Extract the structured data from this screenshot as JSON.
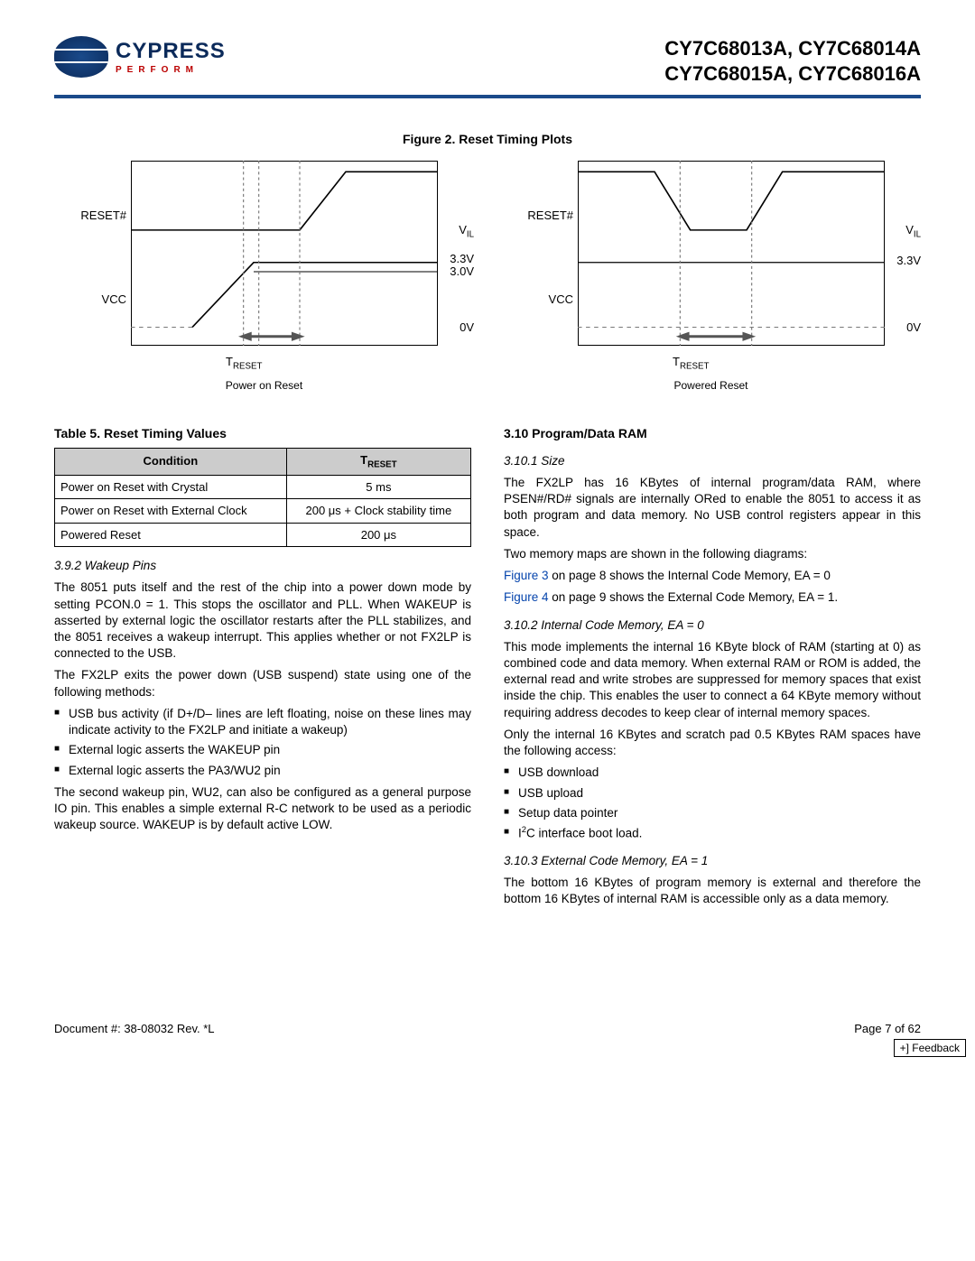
{
  "header": {
    "brand": "CYPRESS",
    "tagline": "PERFORM",
    "parts_line1": "CY7C68013A, CY7C68014A",
    "parts_line2": "CY7C68015A, CY7C68016A"
  },
  "figure": {
    "caption": "Figure 2.  Reset Timing Plots",
    "left": {
      "y_reset": "RESET#",
      "y_vcc": "VCC",
      "r_vil": "VIL",
      "r_33": "3.3V",
      "r_30": "3.0V",
      "r_0": "0V",
      "treset": "TRESET",
      "sub": "Power on Reset"
    },
    "right": {
      "y_reset": "RESET#",
      "y_vcc": "VCC",
      "r_vil": "VIL",
      "r_33": "3.3V",
      "r_0": "0V",
      "treset": "TRESET",
      "sub": "Powered Reset"
    }
  },
  "table5": {
    "caption": "Table 5.  Reset Timing Values",
    "headers": {
      "cond": "Condition",
      "treset": "TRESET"
    },
    "rows": [
      {
        "cond": "Power on Reset with Crystal",
        "val": "5 ms"
      },
      {
        "cond": "Power on Reset with External Clock",
        "val": "200 μs + Clock stability time"
      },
      {
        "cond": "Powered Reset",
        "val": "200 μs"
      }
    ]
  },
  "left": {
    "s392_h": "3.9.2  Wakeup Pins",
    "s392_p1": "The 8051 puts itself and the rest of the chip into a power down mode by setting PCON.0 = 1. This stops the oscillator and PLL. When WAKEUP is asserted by external logic the oscillator restarts after the PLL stabilizes, and the 8051 receives a wakeup interrupt. This applies whether or not FX2LP is connected to the USB.",
    "s392_p2": "The FX2LP exits the power down (USB suspend) state using one of the following methods:",
    "s392_li1": "USB bus activity (if D+/D– lines are left floating, noise on these lines may indicate activity to the FX2LP and initiate a wakeup)",
    "s392_li2": "External logic asserts the WAKEUP pin",
    "s392_li3": "External logic asserts the PA3/WU2 pin",
    "s392_p3": "The second wakeup pin, WU2, can also be configured as a general purpose IO pin. This enables a simple external R-C network to be used as a periodic wakeup source. WAKEUP is by default active LOW."
  },
  "right": {
    "s310_h": "3.10  Program/Data RAM",
    "s3101_h": "3.10.1  Size",
    "s3101_p1": "The FX2LP has 16 KBytes of internal program/data RAM, where PSEN#/RD# signals are internally ORed to enable the 8051 to access it as both program and data memory. No USB control registers appear in this space.",
    "s3101_p2": "Two memory maps are shown in the following diagrams:",
    "s3101_l1a": "Figure 3",
    "s3101_l1b": " on page 8 shows the Internal Code Memory, EA = 0",
    "s3101_l2a": "Figure 4",
    "s3101_l2b": " on page 9 shows the External Code Memory, EA = 1.",
    "s3102_h": "3.10.2  Internal Code Memory, EA = 0",
    "s3102_p1": "This mode implements the internal 16 KByte block of RAM (starting at 0) as combined code and data memory. When external RAM or ROM is added, the external read and write strobes are suppressed for memory spaces that exist inside the chip. This enables the user to connect a 64 KByte memory without requiring address decodes to keep clear of internal memory spaces.",
    "s3102_p2": "Only the internal 16 KBytes and scratch pad 0.5 KBytes RAM spaces have the following access:",
    "s3102_li1": "USB download",
    "s3102_li2": "USB upload",
    "s3102_li3": "Setup data pointer",
    "s3102_li4_a": "I",
    "s3102_li4_b": "C interface boot load.",
    "s3103_h": "3.10.3  External Code Memory, EA = 1",
    "s3103_p1": "The bottom 16 KBytes of program memory is external and therefore the bottom 16 KBytes of internal RAM is accessible only as a data memory."
  },
  "footer": {
    "doc": "Document #: 38-08032 Rev. *L",
    "page": "Page 7 of 62",
    "feedback": "+] Feedback"
  }
}
